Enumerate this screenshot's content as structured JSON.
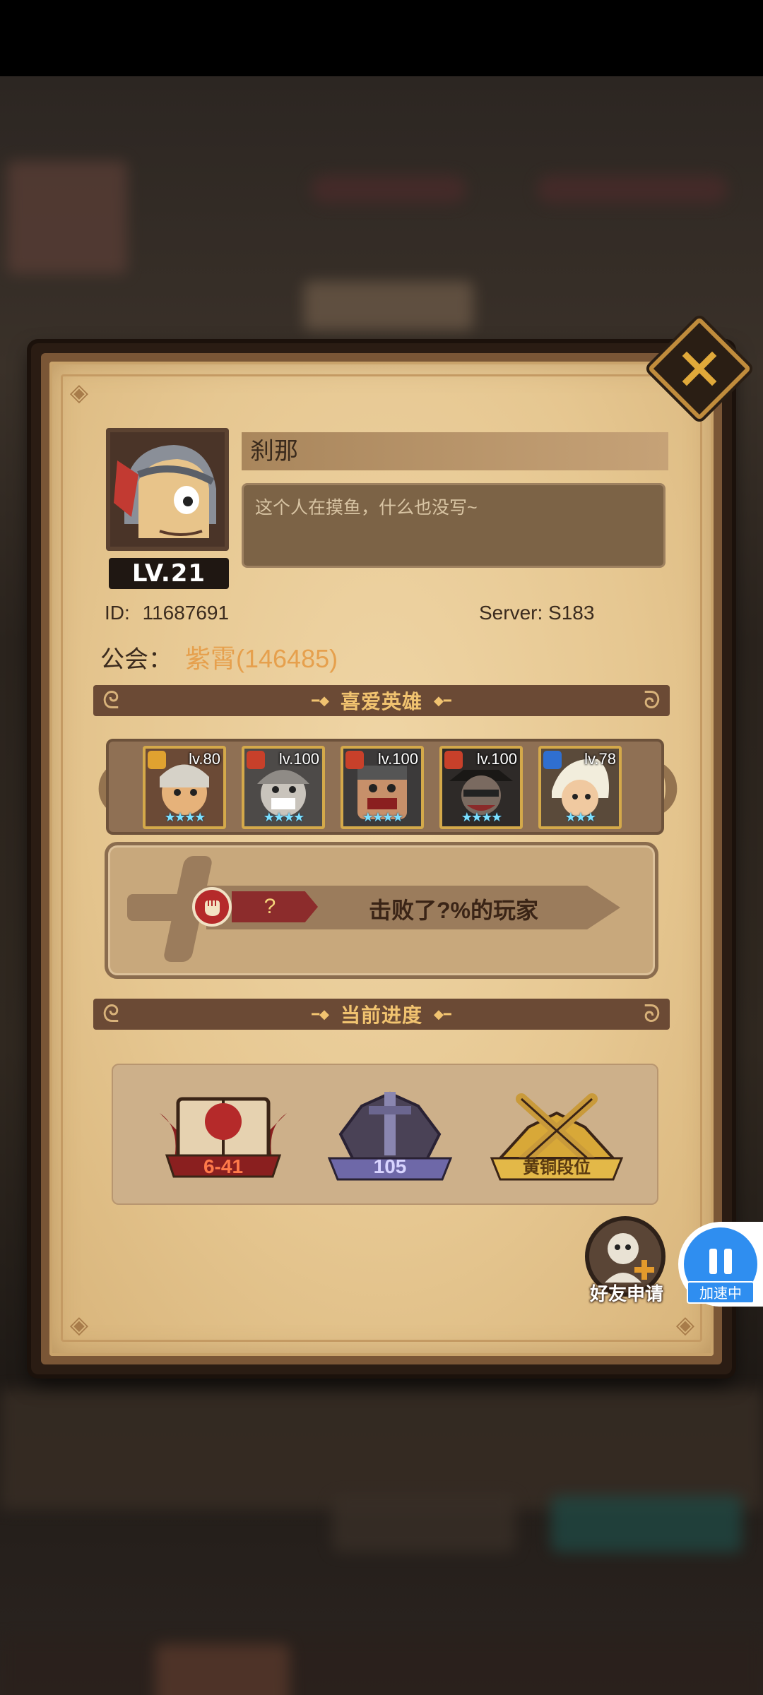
{
  "profile": {
    "level": "LV.21",
    "name": "刹那",
    "signature": "这个人在摸鱼，什么也没写~",
    "id_label": "ID:",
    "id_value": "11687691",
    "server": "Server: S183",
    "guild_label": "公会：",
    "guild_value": "紫霄(146485)"
  },
  "sections": {
    "favorite_heroes": "喜爱英雄",
    "current_progress": "当前进度"
  },
  "heroes": [
    {
      "level": "lv.80",
      "stars": "★★★★",
      "element_color": "#e0a230"
    },
    {
      "level": "lv.100",
      "stars": "★★★★",
      "element_color": "#c8402a"
    },
    {
      "level": "lv.100",
      "stars": "★★★★",
      "element_color": "#c8402a"
    },
    {
      "level": "lv.100",
      "stars": "★★★★",
      "element_color": "#c8402a"
    },
    {
      "level": "lv.78",
      "stars": "★★★",
      "element_color": "#2f6fd0"
    }
  ],
  "defeat": {
    "tag": "?",
    "text": "击败了?%的玩家"
  },
  "progress": {
    "stage": "6-41",
    "tower": "105",
    "rank": "黄铜段位"
  },
  "buttons": {
    "friend_request": "好友申请"
  },
  "overlay": {
    "accelerator_label": "加速中"
  },
  "colors": {
    "guild": "#e6a04d",
    "section_header": "#6b4a35",
    "section_text": "#f1c370",
    "accelerator": "#2f8ef0"
  }
}
